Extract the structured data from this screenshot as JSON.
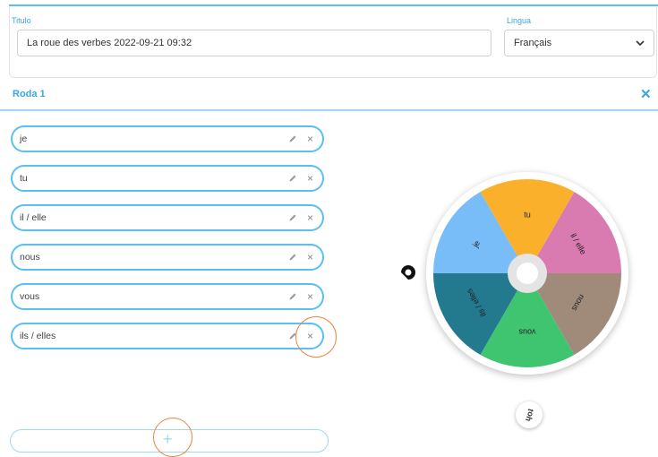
{
  "form": {
    "title_label": "Titulo",
    "title_value": "La roue des verbes 2022-09-21 09:32",
    "language_label": "Lingua",
    "language_value": "Français"
  },
  "section": {
    "title": "Roda 1",
    "close_label": "✕"
  },
  "entries": [
    {
      "label": "je"
    },
    {
      "label": "tu"
    },
    {
      "label": "il / elle"
    },
    {
      "label": "nous"
    },
    {
      "label": "vous"
    },
    {
      "label": "ils / elles"
    }
  ],
  "entry_delete_label": "×",
  "add_label": "+",
  "wheel": {
    "segments": [
      {
        "label": "tu",
        "color": "#fbb02b"
      },
      {
        "label": "il / elle",
        "color": "#d97bb1"
      },
      {
        "label": "nous",
        "color": "#a08a7a"
      },
      {
        "label": "vous",
        "color": "#3fc470"
      },
      {
        "label": "ils / elles",
        "color": "#237a8f"
      },
      {
        "label": "je",
        "color": "#78bdf7"
      }
    ]
  },
  "spin_label": "ɥoʇ",
  "colors": {
    "accent": "#3aa6e0",
    "entry_border": "#5bc0f0",
    "highlight": "#f0853a"
  }
}
